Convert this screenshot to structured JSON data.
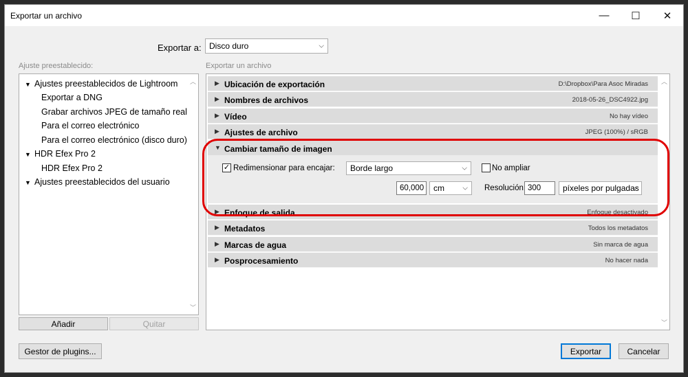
{
  "window": {
    "title": "Exportar un archivo",
    "minimize": "—",
    "maximize": "☐",
    "close": "✕"
  },
  "export_to": {
    "label": "Exportar a:",
    "value": "Disco duro"
  },
  "left": {
    "label": "Ajuste preestablecido:",
    "tree": [
      {
        "label": "Ajustes preestablecidos de Lightroom",
        "expanded": true
      },
      {
        "label": "Exportar a DNG"
      },
      {
        "label": "Grabar archivos JPEG de tamaño real"
      },
      {
        "label": "Para el correo electrónico"
      },
      {
        "label": "Para el correo electrónico (disco duro)"
      },
      {
        "label": "HDR Efex Pro 2",
        "expanded": true
      },
      {
        "label": "HDR Efex Pro 2"
      },
      {
        "label": "Ajustes preestablecidos del usuario",
        "expanded": true
      }
    ],
    "add_button": "Añadir",
    "remove_button": "Quitar"
  },
  "right": {
    "label": "Exportar un archivo",
    "sections": [
      {
        "name": "Ubicación de exportación",
        "summary": "D:\\Dropbox\\Para Asoc Miradas"
      },
      {
        "name": "Nombres de archivos",
        "summary": "2018-05-26_DSC4922.jpg"
      },
      {
        "name": "Vídeo",
        "summary": "No hay vídeo"
      },
      {
        "name": "Ajustes de archivo",
        "summary": "JPEG (100%) / sRGB"
      },
      {
        "name": "Cambiar tamaño de imagen",
        "summary": ""
      },
      {
        "name": "Enfoque de salida",
        "summary": "Enfoque desactivado"
      },
      {
        "name": "Metadatos",
        "summary": "Todos los metadatos"
      },
      {
        "name": "Marcas de agua",
        "summary": "Sin marca de agua"
      },
      {
        "name": "Posprocesamiento",
        "summary": "No hacer nada"
      }
    ],
    "resize": {
      "fit_label": "Redimensionar para encajar:",
      "fit_checked": true,
      "fit_value": "Borde largo",
      "no_enlarge_label": "No ampliar",
      "no_enlarge_checked": false,
      "size_value": "60,000",
      "unit_value": "cm",
      "resolution_label": "Resolución:",
      "resolution_value": "300",
      "resolution_unit": "píxeles por pulgadas"
    }
  },
  "footer": {
    "plugin_manager": "Gestor de plugins...",
    "export": "Exportar",
    "cancel": "Cancelar"
  },
  "colors": {
    "highlight": "#e00000",
    "accent": "#0078d7"
  }
}
